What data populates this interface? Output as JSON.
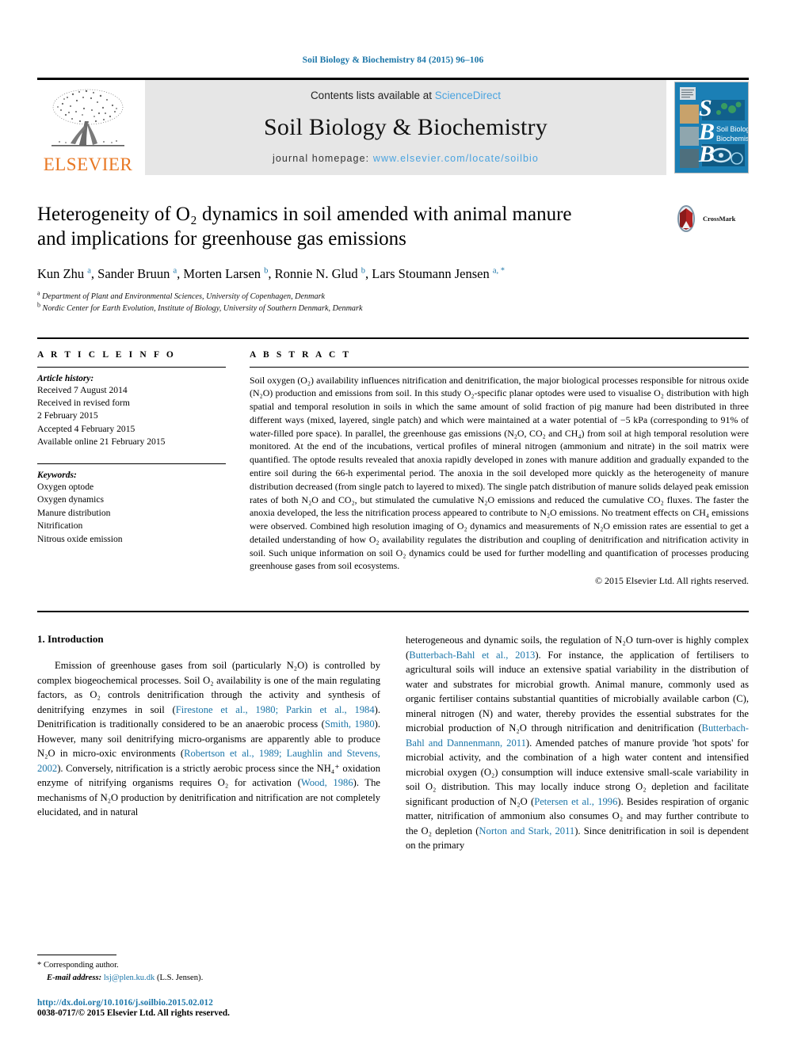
{
  "running_head": "Soil Biology & Biochemistry 84 (2015) 96–106",
  "masthead": {
    "publisher_name": "ELSEVIER",
    "contents_prefix": "Contents lists available at ",
    "sciencedirect": "ScienceDirect",
    "journal_title": "Soil Biology & Biochemistry",
    "homepage_prefix": "journal homepage: ",
    "homepage_url": "www.elsevier.com/locate/soilbio",
    "cover_letters": [
      "S",
      "B",
      "B"
    ],
    "cover_title_line1": "Soil Biology &",
    "cover_title_line2": "Biochemistry",
    "accent_orange": "#e87722",
    "accent_blue": "#4aa3df",
    "cover_blue": "#1b7fb5"
  },
  "article": {
    "title_line1": "Heterogeneity of O₂ dynamics in soil amended with animal manure",
    "title_line2": "and implications for greenhouse gas emissions",
    "authors": "Kun Zhu a, Sander Bruun a, Morten Larsen b, Ronnie N. Glud b, Lars Stoumann Jensen a, *",
    "affiliation_a": "Department of Plant and Environmental Sciences, University of Copenhagen, Denmark",
    "affiliation_b": "Nordic Center for Earth Evolution, Institute of Biology, University of Southern Denmark, Denmark",
    "crossmark_label": "CrossMark"
  },
  "article_info": {
    "heading": "A R T I C L E  I N F O",
    "history_label": "Article history:",
    "history": [
      "Received 7 August 2014",
      "Received in revised form",
      "2 February 2015",
      "Accepted 4 February 2015",
      "Available online 21 February 2015"
    ],
    "keywords_label": "Keywords:",
    "keywords": [
      "Oxygen optode",
      "Oxygen dynamics",
      "Manure distribution",
      "Nitrification",
      "Nitrous oxide emission"
    ]
  },
  "abstract": {
    "heading": "A B S T R A C T",
    "text": "Soil oxygen (O₂) availability influences nitrification and denitrification, the major biological processes responsible for nitrous oxide (N₂O) production and emissions from soil. In this study O₂-specific planar optodes were used to visualise O₂ distribution with high spatial and temporal resolution in soils in which the same amount of solid fraction of pig manure had been distributed in three different ways (mixed, layered, single patch) and which were maintained at a water potential of −5 kPa (corresponding to 91% of water-filled pore space). In parallel, the greenhouse gas emissions (N₂O, CO₂ and CH₄) from soil at high temporal resolution were monitored. At the end of the incubations, vertical profiles of mineral nitrogen (ammonium and nitrate) in the soil matrix were quantified. The optode results revealed that anoxia rapidly developed in zones with manure addition and gradually expanded to the entire soil during the 66-h experimental period. The anoxia in the soil developed more quickly as the heterogeneity of manure distribution decreased (from single patch to layered to mixed). The single patch distribution of manure solids delayed peak emission rates of both N₂O and CO₂, but stimulated the cumulative N₂O emissions and reduced the cumulative CO₂ fluxes. The faster the anoxia developed, the less the nitrification process appeared to contribute to N₂O emissions. No treatment effects on CH₄ emissions were observed. Combined high resolution imaging of O₂ dynamics and measurements of N₂O emission rates are essential to get a detailed understanding of how O₂ availability regulates the distribution and coupling of denitrification and nitrification activity in soil. Such unique information on soil O₂ dynamics could be used for further modelling and quantification of processes producing greenhouse gases from soil ecosystems.",
    "copyright": "© 2015 Elsevier Ltd. All rights reserved."
  },
  "introduction": {
    "section_number": "1.",
    "section_title": "Introduction",
    "left_column_html": "Emission of greenhouse gases from soil (particularly N₂O) is controlled by complex biogeochemical processes. Soil O₂ availability is one of the main regulating factors, as O₂ controls denitrification through the activity and synthesis of denitrifying enzymes in soil (<span class=\"link\">Firestone et al., 1980; Parkin et al., 1984</span>). Denitrification is traditionally considered to be an anaerobic process (<span class=\"link\">Smith, 1980</span>). However, many soil denitrifying micro-organisms are apparently able to produce N₂O in micro-oxic environments (<span class=\"link\">Robertson et al., 1989; Laughlin and Stevens, 2002</span>). Conversely, nitrification is a strictly aerobic process since the NH₄⁺ oxidation enzyme of nitrifying organisms requires O₂ for activation (<span class=\"link\">Wood, 1986</span>). The mechanisms of N₂O production by denitrification and nitrification are not completely elucidated, and in natural",
    "right_column_html": "heterogeneous and dynamic soils, the regulation of N₂O turn-over is highly complex (<span class=\"link\">Butterbach-Bahl et al., 2013</span>). For instance, the application of fertilisers to agricultural soils will induce an extensive spatial variability in the distribution of water and substrates for microbial growth. Animal manure, commonly used as organic fertiliser contains substantial quantities of microbially available carbon (C), mineral nitrogen (N) and water, thereby provides the essential substrates for the microbial production of N₂O through nitrification and denitrification (<span class=\"link\">Butterbach-Bahl and Dannenmann, 2011</span>). Amended patches of manure provide 'hot spots' for microbial activity, and the combination of a high water content and intensified microbial oxygen (O₂) consumption will induce extensive small-scale variability in soil O₂ distribution. This may locally induce strong O₂ depletion and facilitate significant production of N₂O (<span class=\"link\">Petersen et al., 1996</span>). Besides respiration of organic matter, nitrification of ammonium also consumes O₂ and may further contribute to the O₂ depletion (<span class=\"link\">Norton and Stark, 2011</span>). Since denitrification in soil is dependent on the primary"
  },
  "footnote": {
    "corresponding_marker": "*",
    "corresponding_label": "Corresponding author.",
    "email_label": "E-mail address:",
    "email": "lsj@plen.ku.dk",
    "email_owner": "(L.S. Jensen).",
    "doi": "http://dx.doi.org/10.1016/j.soilbio.2015.02.012",
    "issn_line": "0038-0717/© 2015 Elsevier Ltd. All rights reserved."
  }
}
